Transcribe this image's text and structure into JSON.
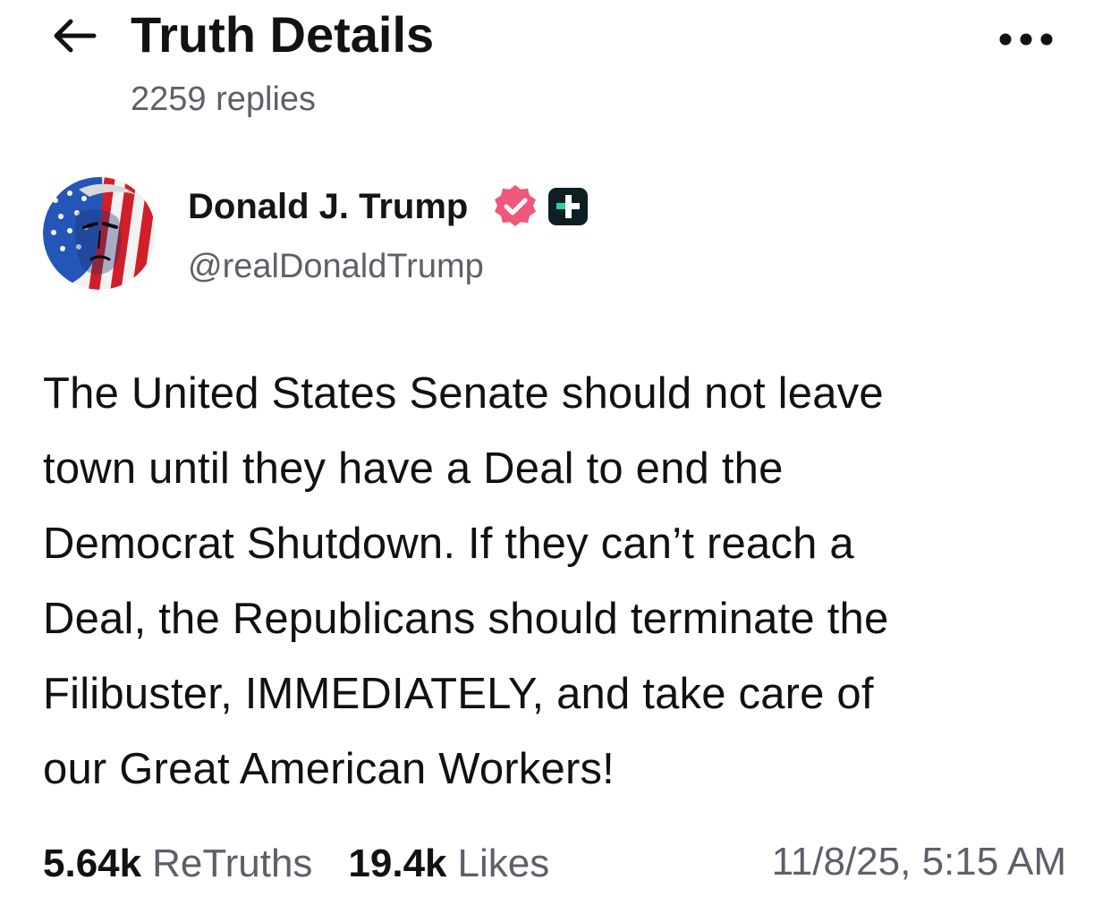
{
  "header": {
    "title": "Truth Details",
    "replies": "2259 replies",
    "back_icon": "arrow-left-icon",
    "more_icon": "more-horizontal-icon"
  },
  "author": {
    "name": "Donald J. Trump",
    "handle": "@realDonaldTrump",
    "verified_icon": "verified-badge-icon",
    "verified_color": "#f0577a",
    "plus_icon": "plus-badge-icon",
    "plus_color": "#0d1f22",
    "plus_accent": "#27d0a6"
  },
  "post": {
    "text": "The United States Senate should not leave\ntown until they have a Deal to end the\nDemocrat Shutdown. If they can’t reach a\nDeal, the Republicans should terminate the\nFilibuster, IMMEDIATELY, and take care of\nour Great American Workers!"
  },
  "stats": {
    "retruths_count": "5.64k",
    "retruths_label": "ReTruths",
    "likes_count": "19.4k",
    "likes_label": "Likes",
    "timestamp": "11/8/25, 5:15 AM"
  },
  "colors": {
    "primary_text": "#111111",
    "secondary_text": "#5f5f6b",
    "background": "#ffffff"
  }
}
